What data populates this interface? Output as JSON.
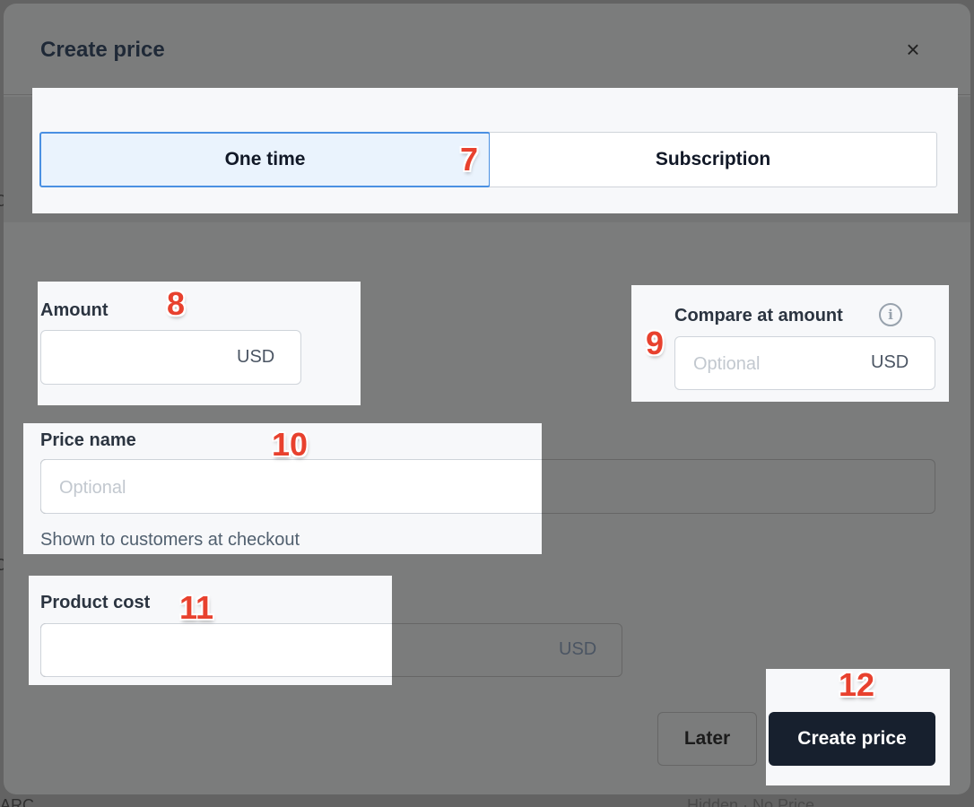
{
  "modal": {
    "title": "Create price",
    "close_glyph": "×"
  },
  "pricing_type": {
    "options": [
      "One time",
      "Subscription"
    ],
    "selected": "One time"
  },
  "fields": {
    "amount": {
      "label": "Amount",
      "value": "",
      "suffix": "USD"
    },
    "compare_at": {
      "label": "Compare at amount",
      "placeholder": "Optional",
      "suffix": "USD",
      "info_glyph": "i"
    },
    "price_name": {
      "label": "Price name",
      "placeholder": "Optional",
      "hint": "Shown to customers at checkout"
    },
    "product_cost": {
      "label": "Product cost",
      "value": "",
      "suffix": "USD"
    }
  },
  "actions": {
    "later_label": "Later",
    "create_label": "Create price"
  },
  "annotations": [
    "7",
    "8",
    "9",
    "10",
    "11",
    "12"
  ],
  "background": {
    "fragment_1": "C",
    "fragment_2": "C",
    "fragment_3": "ARC",
    "fragment_4": "Hidden · No Price"
  },
  "colors": {
    "selected_tab_bg": "#eaf3fd",
    "selected_tab_border": "#4a90e2",
    "primary_button": "#17202e",
    "annotation": "#e8412e"
  }
}
